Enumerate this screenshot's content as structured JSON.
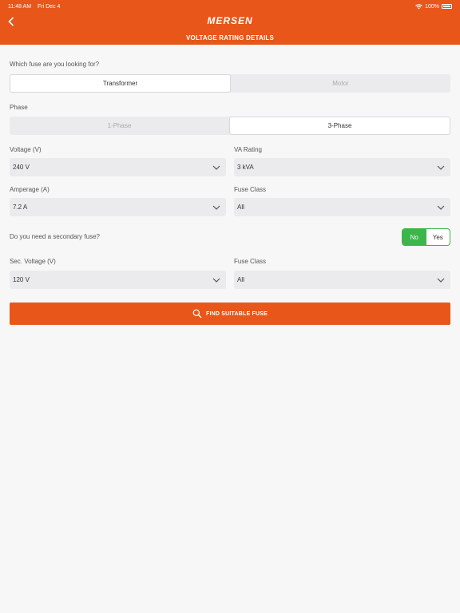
{
  "status_bar": {
    "time": "11:48 AM",
    "date": "Fri Dec 4",
    "battery": "100%"
  },
  "header": {
    "logo": "MERSEN",
    "title": "VOLTAGE RATING DETAILS"
  },
  "fuse_type": {
    "question": "Which fuse are you looking for?",
    "options": [
      "Transformer",
      "Motor"
    ],
    "selected": "Transformer"
  },
  "phase": {
    "label": "Phase",
    "options": [
      "1-Phase",
      "3-Phase"
    ],
    "selected": "3-Phase"
  },
  "fields": {
    "voltage": {
      "label": "Voltage (V)",
      "value": "240 V"
    },
    "va_rating": {
      "label": "VA Rating",
      "value": "3 kVA"
    },
    "amperage": {
      "label": "Amperage (A)",
      "value": "7.2 A"
    },
    "fuse_class": {
      "label": "Fuse Class",
      "value": "All"
    },
    "sec_voltage": {
      "label": "Sec. Voltage (V)",
      "value": "120 V"
    },
    "sec_fuse_class": {
      "label": "Fuse Class",
      "value": "All"
    }
  },
  "secondary": {
    "question": "Do you need a secondary fuse?",
    "no_label": "No",
    "yes_label": "Yes",
    "selected": "No"
  },
  "find_button": {
    "label": "FIND SUITABLE FUSE",
    "icon": "search-icon"
  },
  "colors": {
    "brand": "#e8561a",
    "toggle_green": "#3cb54a"
  }
}
